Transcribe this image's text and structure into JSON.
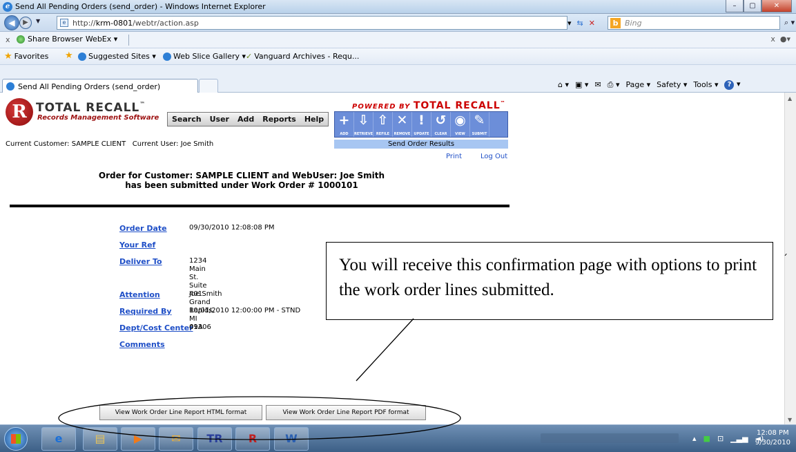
{
  "window": {
    "title": "Send All Pending Orders (send_order) - Windows Internet Explorer",
    "min": "–",
    "max": "▢",
    "close": "✕"
  },
  "address": {
    "url_prefix": "http://",
    "url_host": "krm-0801",
    "url_path": "/webtr/action.asp",
    "search_placeholder": "Bing"
  },
  "toolbar2": {
    "share_label": "Share Browser",
    "webex_label": "WebEx ▾"
  },
  "favorites": {
    "favorites_label": "Favorites",
    "items": [
      "Suggested Sites ▾",
      "Web Slice Gallery ▾",
      "Vanguard Archives - Requ..."
    ]
  },
  "tab": {
    "title": "Send All Pending Orders (send_order)"
  },
  "commandbar": {
    "page": "Page ▾",
    "safety": "Safety ▾",
    "tools": "Tools ▾"
  },
  "app": {
    "logo_letter": "R",
    "name": "TOTAL RECALL",
    "tm": "™",
    "subtitle": "Records Management Software",
    "menu": [
      "Search",
      "User",
      "Add",
      "Reports",
      "Help"
    ],
    "powered_by": "POWERED BY",
    "powered_name": "TOTAL RECALL",
    "actions": [
      {
        "glyph": "+",
        "label": "ADD",
        "icon": "add-icon"
      },
      {
        "glyph": "⇩",
        "label": "RETRIEVE",
        "icon": "retrieve-icon"
      },
      {
        "glyph": "⇧",
        "label": "REFILE",
        "icon": "refile-icon"
      },
      {
        "glyph": "✕",
        "label": "REMOVE",
        "icon": "remove-icon"
      },
      {
        "glyph": "!",
        "label": "UPDATE",
        "icon": "update-icon"
      },
      {
        "glyph": "↺",
        "label": "CLEAR",
        "icon": "clear-icon"
      },
      {
        "glyph": "◉",
        "label": "VIEW",
        "icon": "view-icon"
      },
      {
        "glyph": "✎",
        "label": "SUBMIT",
        "icon": "submit-icon"
      }
    ],
    "current_customer_label": "Current Customer:",
    "current_customer": "SAMPLE CLIENT",
    "current_user_label": "Current User:",
    "current_user": "Joe Smith",
    "results_title": "Send Order Results",
    "print_link": "Print",
    "logout_link": "Log Out"
  },
  "order": {
    "line1": "Order for Customer: SAMPLE CLIENT and WebUser: Joe Smith",
    "line2": "has been submitted under Work Order # 1000101",
    "fields": [
      {
        "label": "Order Date",
        "value": "09/30/2010 12:08:08 PM"
      },
      {
        "label": "Your Ref",
        "value": ""
      },
      {
        "label": "Deliver To",
        "value": "1234 Main St.\nSuite 401\nGrand Rapids, MI 49306"
      },
      {
        "label": "Attention",
        "value": "Joe Smith"
      },
      {
        "label": "Required By",
        "value": "10/01/2010 12:00:00 PM - STND"
      },
      {
        "label": "Dept/Cost Center",
        "value": "01A"
      },
      {
        "label": "Comments",
        "value": ""
      }
    ],
    "btn_html": "View Work Order Line Report HTML format",
    "btn_pdf": "View Work Order Line Report PDF format"
  },
  "callout": {
    "text": "You will receive this confirmation page with options to print the work order lines submitted."
  },
  "taskbar": {
    "clock_time": "12:08 PM",
    "clock_date": "9/30/2010"
  }
}
